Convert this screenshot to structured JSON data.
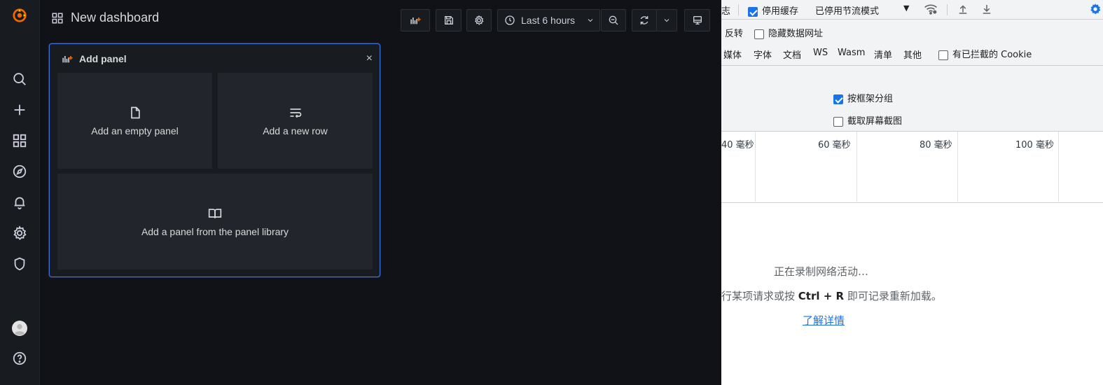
{
  "dashboard": {
    "title": "New dashboard",
    "time_range": "Last 6 hours"
  },
  "add_panel": {
    "header": "Add panel",
    "close": "×",
    "empty_panel": "Add an empty panel",
    "new_row": "Add a new row",
    "from_library": "Add a panel from the panel library"
  },
  "devtools": {
    "toolbar": {
      "log_partial": "志",
      "disable_cache": "停用缓存",
      "throttling": "已停用节流模式",
      "dropdown": "▼"
    },
    "row2": {
      "invert": "反转",
      "hide_data_urls": "隐藏数据网址"
    },
    "filters": [
      "媒体",
      "字体",
      "文档",
      "WS",
      "Wasm",
      "清单",
      "其他"
    ],
    "blocked_cookies": "有已拦截的 Cookie",
    "settings": {
      "group_by_frame": "按框架分组",
      "capture_screenshots": "截取屏幕截图"
    },
    "timeline_labels": [
      "40 毫秒",
      "60 毫秒",
      "80 毫秒",
      "100 毫秒"
    ],
    "recording": {
      "line1": "正在录制网络活动…",
      "line2_prefix": "行某项请求或按 ",
      "line2_keys": "Ctrl + R",
      "line2_suffix": " 即可记录重新加载。",
      "learn_more": "了解详情"
    }
  },
  "colors": {
    "grafana_bg": "#111217",
    "grafana_sidebar": "#181b1f",
    "panel_border": "#3d71d9",
    "grafana_orange": "#f46800",
    "devtools_blue": "#1a73e8"
  }
}
